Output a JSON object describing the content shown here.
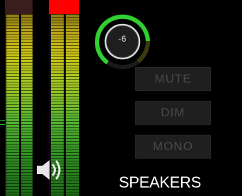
{
  "knob": {
    "value": "-6"
  },
  "buttons": {
    "mute": "MUTE",
    "dim": "DIM",
    "mono": "MONO"
  },
  "section": {
    "label": "SPEAKERS"
  },
  "meters": {
    "left": {
      "peak_clip": false,
      "peak_color": "#3a1d1d"
    },
    "right": {
      "peak_clip": true,
      "peak_color": "#ff0000"
    }
  },
  "colors": {
    "background": "#000000",
    "knob_arc": "#2fd12f",
    "button_bg": "#1f1f1f",
    "button_text": "#4a4a4a",
    "label_text": "#ffffff"
  },
  "icons": {
    "speaker": "speaker-volume-icon"
  }
}
